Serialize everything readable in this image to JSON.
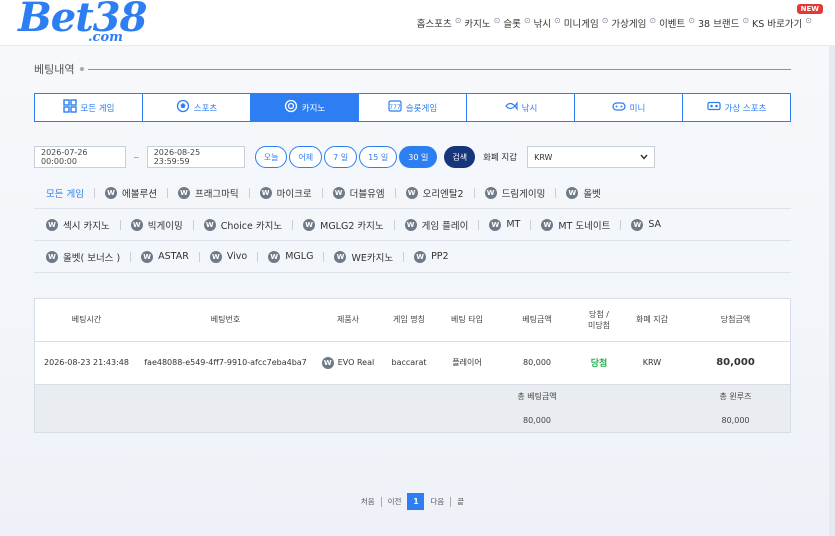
{
  "brand": {
    "logo_text": "Bet38",
    "logo_sub": ".com",
    "new_badge": "NEW"
  },
  "topnav": {
    "items": [
      "홈스포츠",
      "카지노",
      "슬롯",
      "낚시",
      "미니게임",
      "가상게임",
      "이벤트",
      "38 브랜드",
      "KS 바로가기"
    ],
    "separator_icon": "check-circle-icon"
  },
  "section": {
    "title": "베팅내역"
  },
  "category_tabs": [
    {
      "label": "모든 게임",
      "icon": "grid-icon",
      "active": false
    },
    {
      "label": "스포츠",
      "icon": "soccer-ball-icon",
      "active": false
    },
    {
      "label": "카지노",
      "icon": "casino-chip-icon",
      "active": true
    },
    {
      "label": "슬롯게임",
      "icon": "slot-777-icon",
      "active": false
    },
    {
      "label": "낚시",
      "icon": "fish-icon",
      "active": false
    },
    {
      "label": "미니",
      "icon": "gamepad-icon",
      "active": false
    },
    {
      "label": "가상 스포츠",
      "icon": "vr-icon",
      "active": false
    }
  ],
  "filters": {
    "start_date": "2026-07-26 00:00:00",
    "separator": "~",
    "end_date": "2026-08-25 23:59:59",
    "ranges": [
      {
        "label": "오늘",
        "active": false
      },
      {
        "label": "어제",
        "active": false
      },
      {
        "label": "7 일",
        "active": false
      },
      {
        "label": "15 일",
        "active": false
      },
      {
        "label": "30 일",
        "active": true
      }
    ],
    "search_label": "검색",
    "currency_label": "화폐 지갑",
    "currency_value": "KRW",
    "accent": "#2c7ef2",
    "dark_accent": "#17357a"
  },
  "providers": {
    "row1": [
      {
        "label": "모든 게임",
        "active": true,
        "icon": false
      },
      {
        "label": "에볼루션",
        "active": false,
        "icon": true
      },
      {
        "label": "프래그마틱",
        "active": false,
        "icon": true
      },
      {
        "label": "마이크로",
        "active": false,
        "icon": true
      },
      {
        "label": "더블유엠",
        "active": false,
        "icon": true
      },
      {
        "label": "오리엔탈2",
        "active": false,
        "icon": true
      },
      {
        "label": "드림게이밍",
        "active": false,
        "icon": true
      },
      {
        "label": "올벳",
        "active": false,
        "icon": true
      }
    ],
    "row2": [
      {
        "label": "섹시 카지노",
        "icon": true
      },
      {
        "label": "빅게이밍",
        "icon": true
      },
      {
        "label": "Choice 카지노",
        "icon": true
      },
      {
        "label": "MGLG2 카지노",
        "icon": true
      },
      {
        "label": "게임 플레이",
        "icon": true
      },
      {
        "label": "MT",
        "icon": true
      },
      {
        "label": "MT 도네이트",
        "icon": true
      },
      {
        "label": "SA",
        "icon": true
      }
    ],
    "row3": [
      {
        "label": "올벳( 보너스 )",
        "icon": true
      },
      {
        "label": "ASTAR",
        "icon": true
      },
      {
        "label": "Vivo",
        "icon": true
      },
      {
        "label": "MGLG",
        "icon": true
      },
      {
        "label": "WE카지노",
        "icon": true
      },
      {
        "label": "PP2",
        "icon": true
      }
    ],
    "icon_letter": "W"
  },
  "table": {
    "headers": {
      "time": "베팅시간",
      "id": "베팅번호",
      "provider": "제품사",
      "game": "게임 명칭",
      "bet_type": "베팅 타입",
      "amount": "베팅금액",
      "result_line1": "당첨 /",
      "result_line2": "미당첨",
      "wallet": "화폐 지갑",
      "win_amount": "당첨금액"
    },
    "rows": [
      {
        "time": "2026-08-23 21:43:48",
        "id": "fae48088-e549-4ff7-9910-afcc7eba4ba7",
        "provider": "EVO Real",
        "game": "baccarat",
        "bet_type": "플레이어",
        "amount": "80,000",
        "result": "당첨",
        "wallet": "KRW",
        "win_amount": "80,000"
      }
    ],
    "summary": {
      "total_bet_label": "총 베팅금액",
      "total_bet_value": "80,000",
      "total_win_label": "총 윈루즈",
      "total_win_value": "80,000"
    },
    "win_color": "#22b14c"
  },
  "pagination": {
    "first": "처음",
    "prev": "이전",
    "current": "1",
    "next": "다음",
    "last": "끝"
  }
}
